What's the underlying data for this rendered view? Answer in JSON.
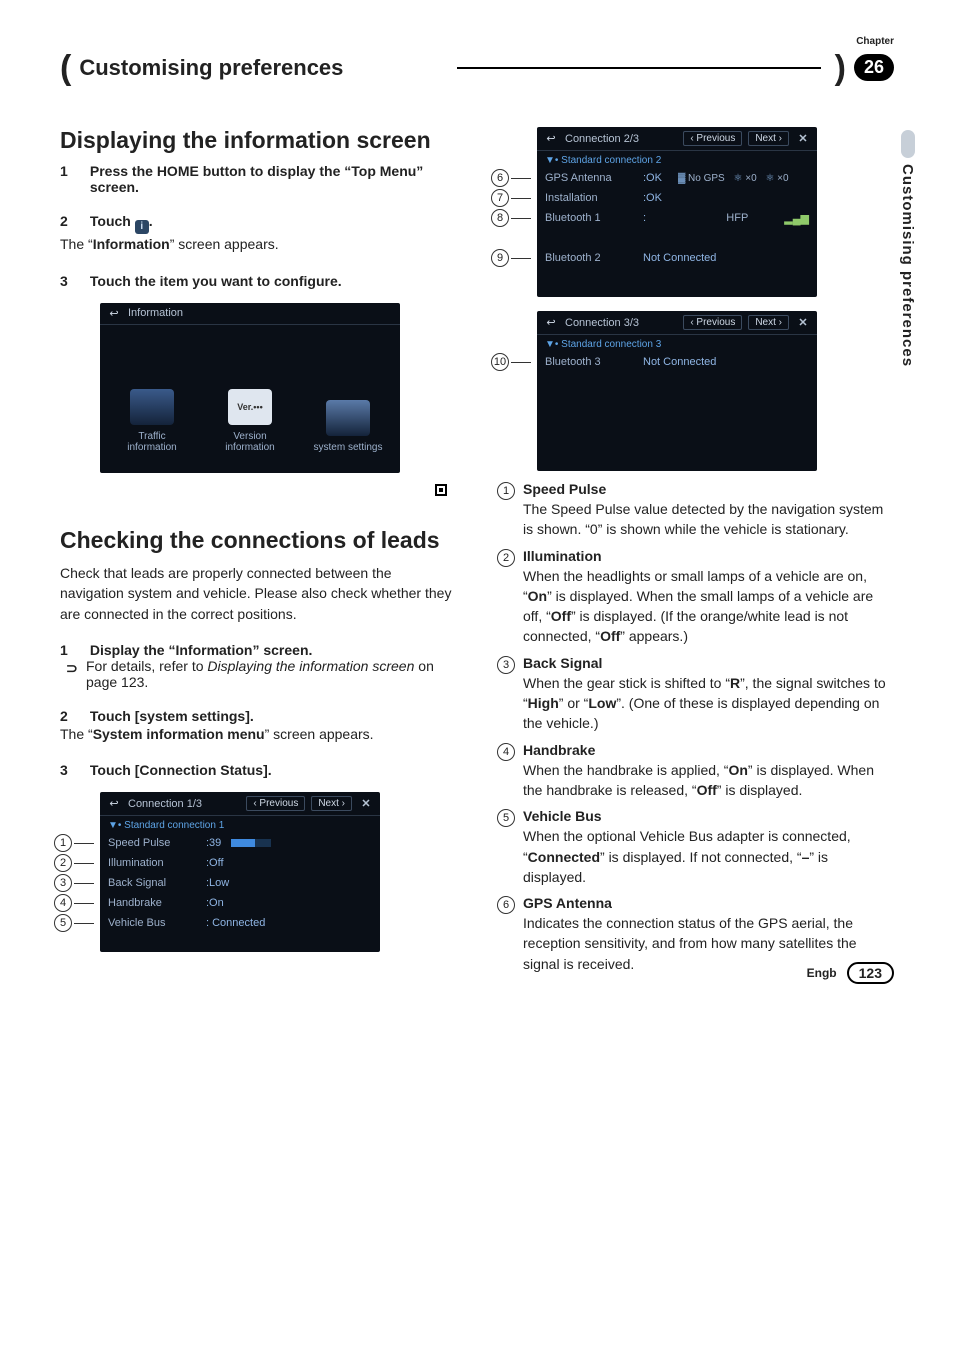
{
  "meta": {
    "chapter_label": "Chapter",
    "chapter_number": "26",
    "header_title": "Customising preferences",
    "vertical_tab": "Customising preferences",
    "lang": "Engb",
    "page_number": "123"
  },
  "left": {
    "h_displaying": "Displaying the information screen",
    "step1_num": "1",
    "step1": "Press the HOME button to display the “Top Menu” screen.",
    "step2_num": "2",
    "step2_pre": "Touch ",
    "step2_icon_alt": "i",
    "step2_post": ".",
    "step2_desc_pre": "The “",
    "step2_desc_bold": "Information",
    "step2_desc_post": "” screen appears.",
    "step3_num": "3",
    "step3": "Touch the item you want to configure.",
    "info_shot": {
      "back": "↩",
      "title": "Information",
      "tiles": [
        {
          "icon": "car",
          "label1": "Traffic",
          "label2": "information"
        },
        {
          "icon": "ver",
          "ver_text": "Ver.•••",
          "label1": "Version",
          "label2": "information"
        },
        {
          "icon": "sys",
          "label1": "system settings",
          "label2": ""
        }
      ]
    },
    "h_checking": "Checking the connections of leads",
    "checking_p": "Check that leads are properly connected between the navigation system and vehicle. Please also check whether they are connected in the correct positions.",
    "c_step1_num": "1",
    "c_step1": "Display the “Information” screen.",
    "c_step1_sub_arrow": "⊃",
    "c_step1_sub_pre": "For details, refer to ",
    "c_step1_sub_italic": "Displaying the information screen",
    "c_step1_sub_post": " on page 123.",
    "c_step2_num": "2",
    "c_step2": "Touch [system settings].",
    "c_step2_desc_pre": "The “",
    "c_step2_desc_bold": "System information menu",
    "c_step2_desc_post": "” screen appears.",
    "c_step3_num": "3",
    "c_step3": "Touch [Connection Status].",
    "conn1": {
      "back": "↩",
      "title": "Connection 1/3",
      "prev": "‹ Previous",
      "next": "Next  ›",
      "close": "✕",
      "subtitle": "▼• Standard connection 1",
      "rows": [
        {
          "n": "1",
          "label": "Speed Pulse",
          "val": ":39",
          "bars": true
        },
        {
          "n": "2",
          "label": "Illumination",
          "val": ":Off"
        },
        {
          "n": "3",
          "label": "Back Signal",
          "val": ":Low"
        },
        {
          "n": "4",
          "label": "Handbrake",
          "val": ":On"
        },
        {
          "n": "5",
          "label": "Vehicle Bus",
          "val": ": Connected"
        }
      ]
    }
  },
  "right": {
    "conn2": {
      "back": "↩",
      "title": "Connection 2/3",
      "prev": "‹ Previous",
      "next": "Next  ›",
      "close": "✕",
      "subtitle": "▼• Standard connection 2",
      "rows": [
        {
          "n": "6",
          "label": "GPS Antenna",
          "val": ":OK",
          "gps": true,
          "gps_text": "No GPS",
          "gps_x0a": "×0",
          "gps_x0b": "×0"
        },
        {
          "n": "7",
          "label": "Installation",
          "val": ":OK"
        },
        {
          "n": "8",
          "label": "Bluetooth 1",
          "val": ":",
          "bt1": true,
          "hfp": "HFP",
          "sig": "▂▄▆"
        },
        {
          "n": "",
          "label": "",
          "val": "",
          "bt_addr": true,
          "addr": " "
        },
        {
          "n": "9",
          "label": "Bluetooth 2",
          "val": "Not Connected"
        }
      ]
    },
    "conn3": {
      "back": "↩",
      "title": "Connection 3/3",
      "prev": "‹ Previous",
      "next": "Next  ›",
      "close": "✕",
      "subtitle": "▼• Standard connection 3",
      "rows": [
        {
          "n": "10",
          "label": "Bluetooth 3",
          "val": "Not Connected"
        }
      ]
    },
    "defs": [
      {
        "n": "1",
        "title": "Speed Pulse",
        "desc": "The Speed Pulse value detected by the navigation system is shown. “0” is shown while the vehicle is stationary."
      },
      {
        "n": "2",
        "title": "Illumination",
        "desc": "When the headlights or small lamps of a vehicle are on, “<b>On</b>” is displayed. When the small lamps of a vehicle are off, “<b>Off</b>” is displayed. (If the orange/white lead is not connected, “<b>Off</b>” appears.)"
      },
      {
        "n": "3",
        "title": "Back Signal",
        "desc": "When the gear stick is shifted to “<b>R</b>”, the signal switches to “<b>High</b>” or “<b>Low</b>”. (One of these is displayed depending on the vehicle.)"
      },
      {
        "n": "4",
        "title": "Handbrake",
        "desc": "When the handbrake is applied, “<b>On</b>” is displayed. When the handbrake is released, “<b>Off</b>” is displayed."
      },
      {
        "n": "5",
        "title": "Vehicle Bus",
        "desc": "When the optional Vehicle Bus adapter is connected, “<b>Connected</b>” is displayed. If not connected, “<b>–</b>” is displayed."
      },
      {
        "n": "6",
        "title": "GPS Antenna",
        "desc": "Indicates the connection status of the GPS aerial, the reception sensitivity, and from how many satellites the signal is received."
      }
    ]
  }
}
